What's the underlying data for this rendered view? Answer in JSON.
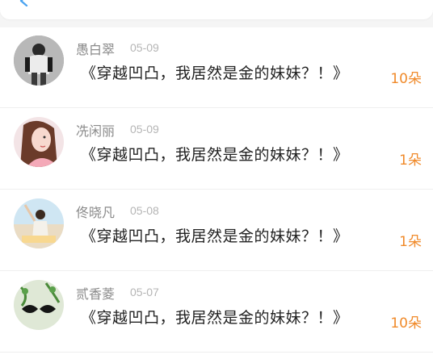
{
  "header": {
    "back_icon": "chevron-left-icon",
    "accent_color": "#4aa3f0"
  },
  "records": [
    {
      "name": "愚白翠",
      "date": "05-09",
      "book_title": "《穿越凹凸，我居然是金的妹妹？！》",
      "flowers": "10朵",
      "avatar_icon": "user-avatar-photo"
    },
    {
      "name": "冼闲丽",
      "date": "05-09",
      "book_title": "《穿越凹凸，我居然是金的妹妹？！》",
      "flowers": "1朵",
      "avatar_icon": "user-avatar-photo"
    },
    {
      "name": "佟晓凡",
      "date": "05-08",
      "book_title": "《穿越凹凸，我居然是金的妹妹？！》",
      "flowers": "1朵",
      "avatar_icon": "user-avatar-photo"
    },
    {
      "name": "贰香菱",
      "date": "05-07",
      "book_title": "《穿越凹凸，我居然是金的妹妹？！》",
      "flowers": "10朵",
      "avatar_icon": "user-avatar-photo"
    }
  ],
  "colors": {
    "name": "#8a8a8a",
    "date": "#b5b5b5",
    "title": "#222222",
    "flowers": "#f08a2a"
  }
}
